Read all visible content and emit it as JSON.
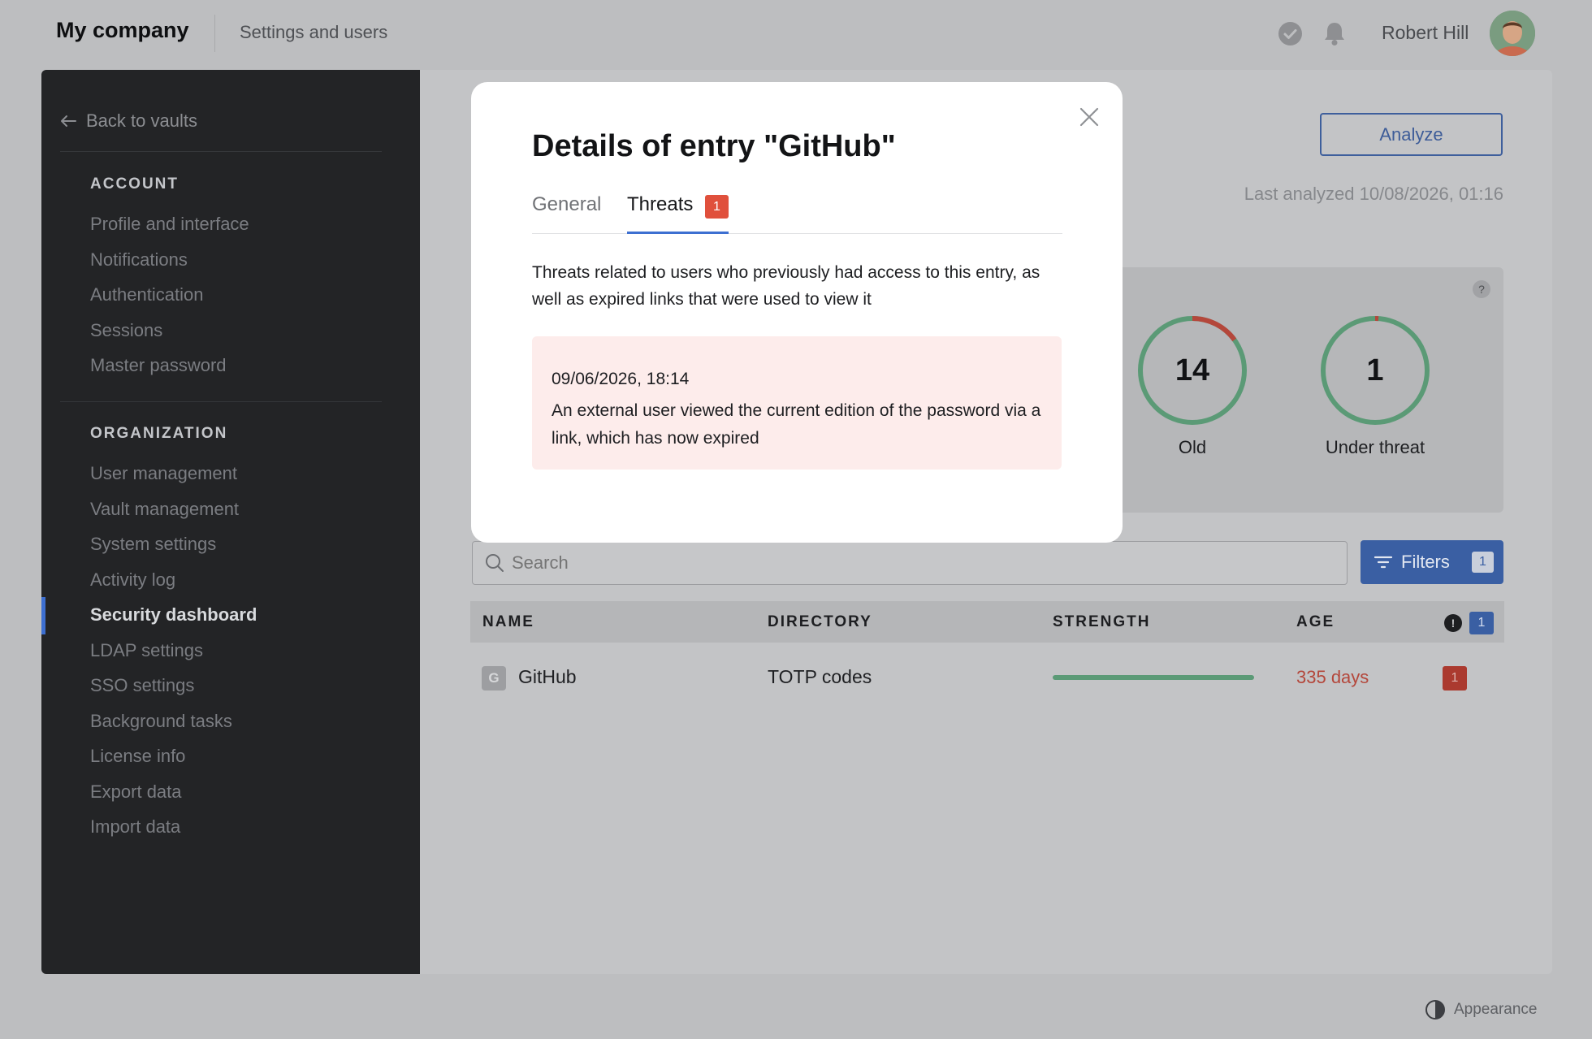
{
  "topbar": {
    "brand": "My company",
    "subtitle": "Settings and users",
    "user_name": "Robert Hill",
    "icons": [
      "check-circle-icon",
      "bell-icon"
    ]
  },
  "sidebar": {
    "back_label": "Back to vaults",
    "account_heading": "ACCOUNT",
    "account_items": [
      "Profile and interface",
      "Notifications",
      "Authentication",
      "Sessions",
      "Master password"
    ],
    "organization_heading": "ORGANIZATION",
    "organization_items": [
      "User management",
      "Vault management",
      "System settings",
      "Activity log",
      "Security dashboard",
      "LDAP settings",
      "SSO settings",
      "Background tasks",
      "License info",
      "Export data",
      "Import data"
    ],
    "active_item": "Security dashboard"
  },
  "dashboard": {
    "analyze_label": "Analyze",
    "last_analyzed": "Last analyzed 10/08/2026, 01:16",
    "help_label": "?",
    "gauges": [
      {
        "value": "14",
        "label": "Old",
        "fraction_red": 0.15
      },
      {
        "value": "1",
        "label": "Under threat",
        "fraction_red": 0.01
      }
    ],
    "search_placeholder": "Search",
    "filters_label": "Filters",
    "filters_count": "1",
    "table": {
      "headers": [
        "NAME",
        "DIRECTORY",
        "STRENGTH",
        "AGE"
      ],
      "alert_icon": "!",
      "alert_count": "1",
      "rows": [
        {
          "icon_letter": "G",
          "name": "GitHub",
          "directory": "TOTP codes",
          "strength": 1.0,
          "age": "335 days",
          "threats": "1"
        }
      ]
    }
  },
  "modal": {
    "title": "Details of entry \"GitHub\"",
    "tabs": [
      "General",
      "Threats"
    ],
    "active_tab": "Threats",
    "threats_count": "1",
    "description": "Threats related to users who previously had access to this entry, as well as expired links that were used to view it",
    "threat": {
      "date": "09/06/2026, 18:14",
      "text": "An external user viewed the current edition of the password via a link, which has now expired"
    }
  },
  "footer": {
    "appearance_label": "Appearance"
  },
  "colors": {
    "accent": "#3d6fd1",
    "danger": "#e0503c",
    "success": "#5b9a76",
    "sidebar_bg": "#232426"
  }
}
